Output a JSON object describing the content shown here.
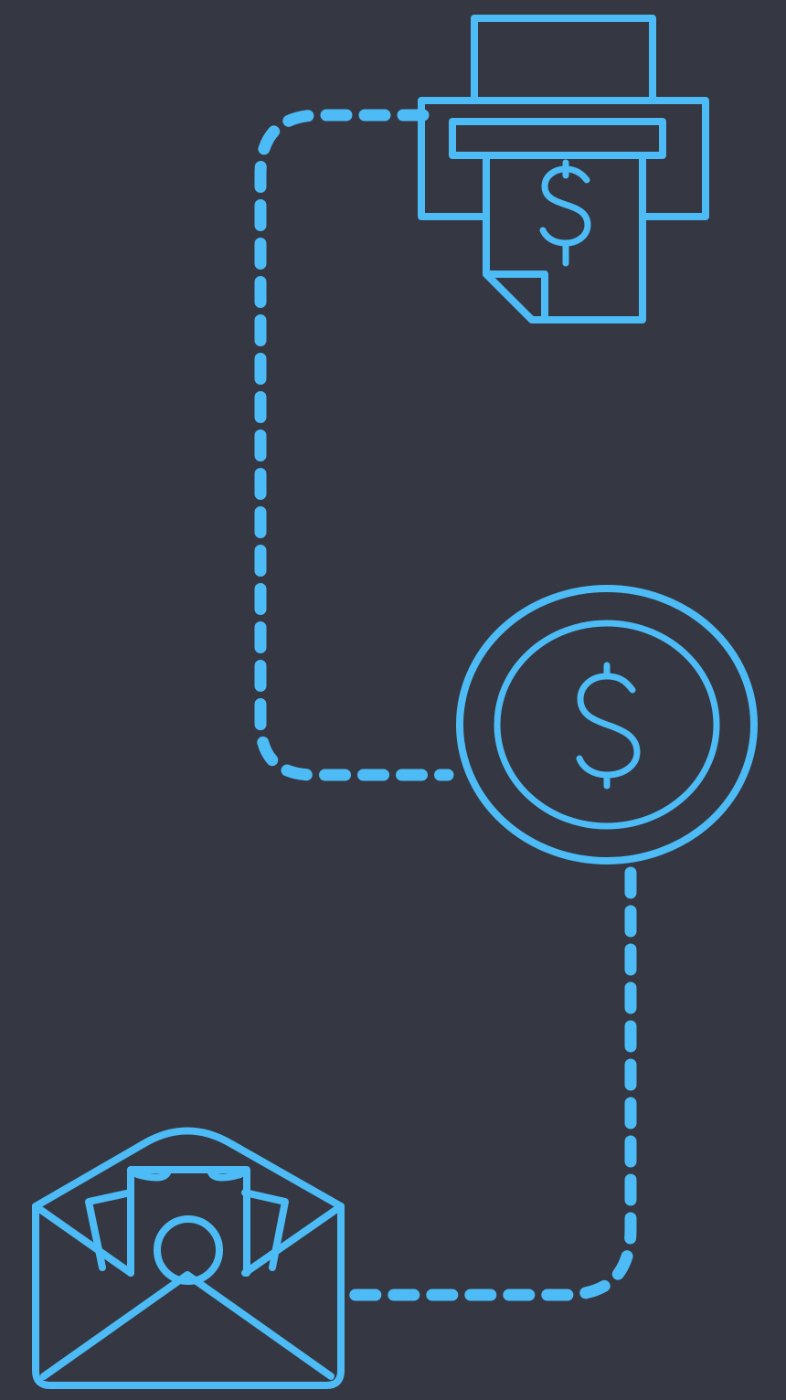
{
  "colors": {
    "background": "#353742",
    "accent": "#4dbbf5"
  },
  "nodes": [
    {
      "id": "printer",
      "icon": "printer-money-icon"
    },
    {
      "id": "coin",
      "icon": "dollar-coin-icon"
    },
    {
      "id": "envelope",
      "icon": "money-envelope-icon"
    }
  ],
  "connectors": [
    {
      "from": "printer",
      "to": "coin",
      "style": "dashed"
    },
    {
      "from": "coin",
      "to": "envelope",
      "style": "dashed"
    }
  ]
}
